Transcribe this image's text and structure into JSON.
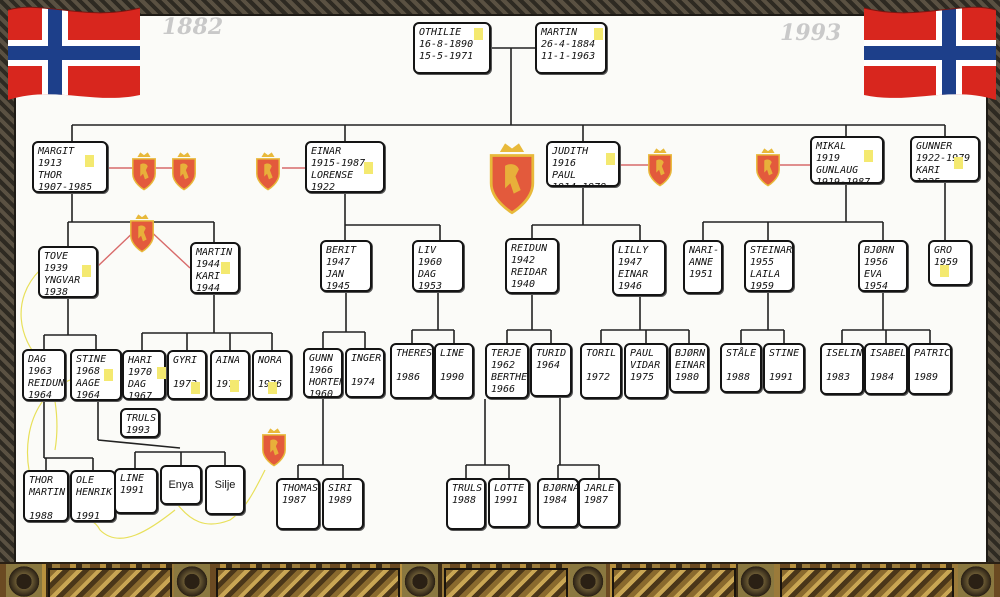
{
  "years": {
    "start": "1882",
    "end": "1993"
  },
  "cards": [
    {
      "id": "othilie",
      "lines": [
        "OTHILIE",
        "16-8-1890",
        "15-5-1971"
      ]
    },
    {
      "id": "martin-sr",
      "lines": [
        "MARTIN",
        "26-4-1884",
        "11-1-1963"
      ]
    },
    {
      "id": "margit",
      "lines": [
        "MARGIT",
        "1913",
        "THOR",
        "1907-1985"
      ]
    },
    {
      "id": "einar-sr",
      "lines": [
        "EINAR",
        "1915-1987",
        "LORENSE",
        "1922"
      ]
    },
    {
      "id": "judith",
      "lines": [
        "JUDITH",
        "1916",
        "PAUL",
        "1914-1978"
      ]
    },
    {
      "id": "mikal",
      "lines": [
        "MIKAL",
        "1919",
        "GUNLAUG",
        "1919-1987"
      ]
    },
    {
      "id": "gunner",
      "lines": [
        "GUNNER",
        "1922-1979",
        "KARI",
        "1925"
      ]
    },
    {
      "id": "tove",
      "lines": [
        "TOVE",
        "1939",
        "YNGVAR",
        "1938"
      ]
    },
    {
      "id": "martin-kari",
      "lines": [
        "MARTIN",
        "1944",
        "KARI",
        "1944"
      ]
    },
    {
      "id": "berit",
      "lines": [
        "BERIT",
        "1947",
        "JAN",
        "1945"
      ]
    },
    {
      "id": "liv",
      "lines": [
        "LIV",
        "1960",
        "DAG",
        "1953"
      ]
    },
    {
      "id": "reidun",
      "lines": [
        "REIDUN",
        "1942",
        "REIDAR",
        "1940"
      ]
    },
    {
      "id": "lilly",
      "lines": [
        "LILLY",
        "1947",
        "EINAR",
        "1946"
      ]
    },
    {
      "id": "nari-anne",
      "lines": [
        "NARI-",
        "ANNE",
        "1951"
      ]
    },
    {
      "id": "steinar",
      "lines": [
        "STEINAR",
        "1955",
        "LAILA",
        "1959"
      ]
    },
    {
      "id": "bjorn",
      "lines": [
        "BJØRN",
        "1956",
        "EVA",
        "1954"
      ]
    },
    {
      "id": "gro",
      "lines": [
        "GRO",
        "1959"
      ]
    },
    {
      "id": "dag",
      "lines": [
        "DAG",
        "1963",
        "REIDUN",
        "1964"
      ]
    },
    {
      "id": "stine-aage",
      "lines": [
        "STINE",
        "1968",
        "AAGE",
        "1964"
      ]
    },
    {
      "id": "hari",
      "lines": [
        "HARI",
        "1970",
        "DAG",
        "1967"
      ]
    },
    {
      "id": "gyri",
      "lines": [
        "GYRI",
        "",
        "1973"
      ]
    },
    {
      "id": "aina",
      "lines": [
        "AINA",
        "",
        "1975"
      ]
    },
    {
      "id": "nora",
      "lines": [
        "NORA",
        "",
        "1976"
      ]
    },
    {
      "id": "gunn",
      "lines": [
        "GUNN",
        "1966",
        "HORTEN",
        "1960"
      ]
    },
    {
      "id": "inger",
      "lines": [
        "INGER",
        "",
        "1974"
      ]
    },
    {
      "id": "therese",
      "lines": [
        "THERESE",
        "",
        "1986"
      ]
    },
    {
      "id": "line-b",
      "lines": [
        "LINE",
        "",
        "1990"
      ]
    },
    {
      "id": "terje",
      "lines": [
        "TERJE",
        "1962",
        "BERTHE",
        "1966"
      ]
    },
    {
      "id": "turid",
      "lines": [
        "TURID",
        "1964"
      ]
    },
    {
      "id": "toril",
      "lines": [
        "TORIL",
        "",
        "1972"
      ]
    },
    {
      "id": "paul-vidar",
      "lines": [
        "PAUL",
        "VIDAR",
        "1975"
      ]
    },
    {
      "id": "bjorn-einar",
      "lines": [
        "BJØRN",
        "EINAR",
        "1980"
      ]
    },
    {
      "id": "stale",
      "lines": [
        "STÅLE",
        "",
        "1988"
      ]
    },
    {
      "id": "stine-b",
      "lines": [
        "STINE",
        "",
        "1991"
      ]
    },
    {
      "id": "iselin",
      "lines": [
        "ISELIN",
        "",
        "1983"
      ]
    },
    {
      "id": "isabell",
      "lines": [
        "ISABELL",
        "",
        "1984"
      ]
    },
    {
      "id": "patrick",
      "lines": [
        "PATRICK",
        "",
        "1989"
      ]
    },
    {
      "id": "truls-a",
      "lines": [
        "TRULS",
        "1993"
      ]
    },
    {
      "id": "thor-martin",
      "lines": [
        "THOR",
        "MARTIN",
        "",
        "1988"
      ]
    },
    {
      "id": "ole-henrik",
      "lines": [
        "OLE",
        "HENRIK",
        "",
        "1991"
      ]
    },
    {
      "id": "line-c",
      "lines": [
        "LINE",
        "1991"
      ]
    },
    {
      "id": "enya",
      "lines": [
        "Enya"
      ]
    },
    {
      "id": "silje",
      "lines": [
        "Silje"
      ]
    },
    {
      "id": "thomas",
      "lines": [
        "THOMAS",
        "1987"
      ]
    },
    {
      "id": "siri",
      "lines": [
        "SIRI",
        "1989"
      ]
    },
    {
      "id": "truls-b",
      "lines": [
        "TRULS",
        "1988"
      ]
    },
    {
      "id": "lotte",
      "lines": [
        "LOTTE",
        "1991"
      ]
    },
    {
      "id": "bjornar",
      "lines": [
        "BJØRNAR",
        "1984"
      ]
    },
    {
      "id": "jarle",
      "lines": [
        "JARLE",
        "1987"
      ]
    }
  ],
  "colors": {
    "paper": "#fbfbf8",
    "connector": "#222222",
    "marriage": "#d86a6a",
    "highlight": "#f4e970",
    "flag_red": "#d8261e",
    "flag_blue": "#1d3f8a",
    "crest_red": "#e35a3c",
    "crest_gold": "#e8b93a"
  },
  "icons": {
    "flag": "norwegian-flag-icon",
    "crest": "norwegian-coat-of-arms-icon"
  }
}
